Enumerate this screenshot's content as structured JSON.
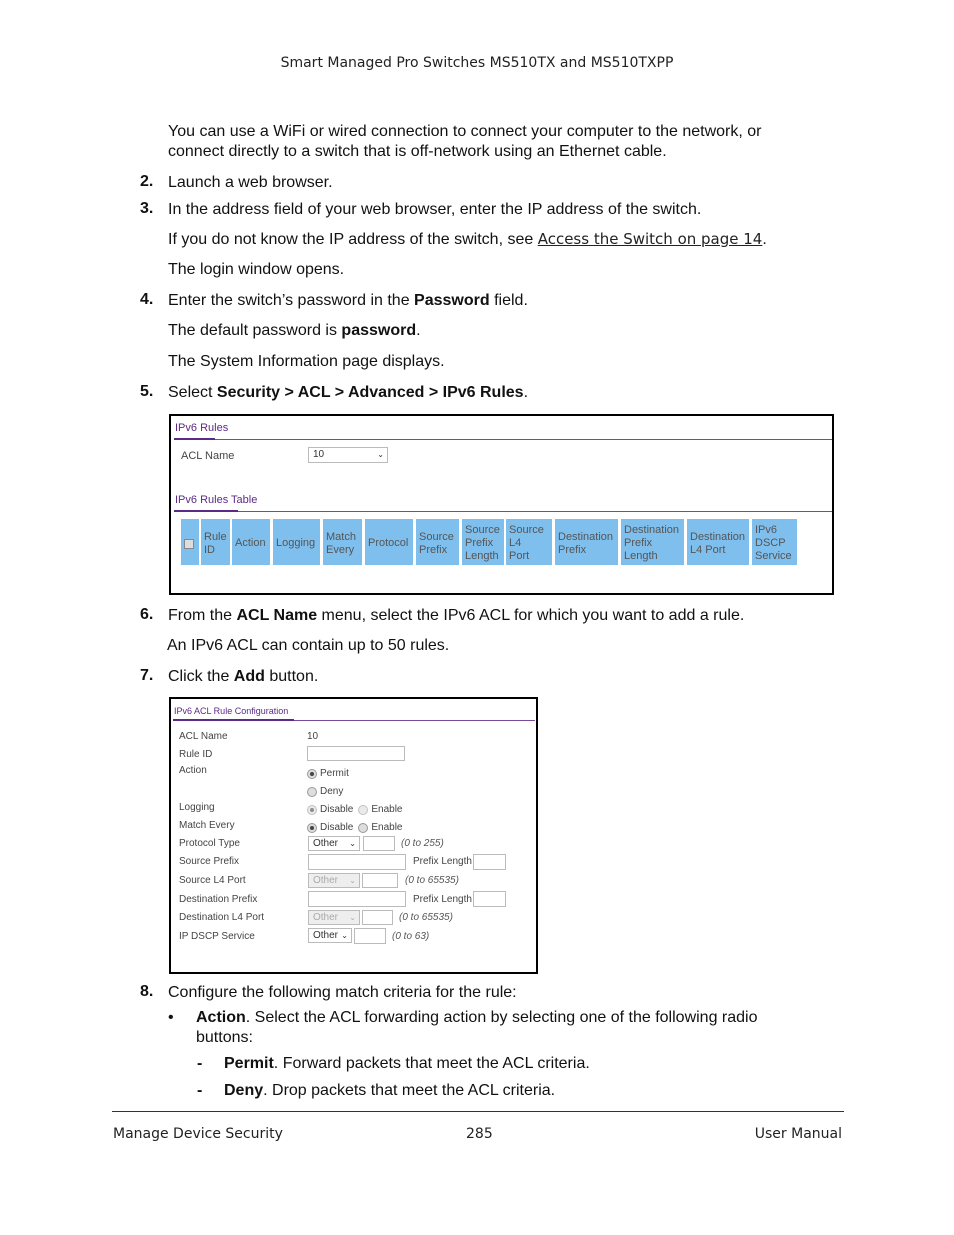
{
  "header": {
    "title": "Smart Managed Pro Switches MS510TX and MS510TXPP"
  },
  "body": {
    "intro": [
      "You can use a WiFi or wired connection to connect your computer to the network, or",
      "connect directly to a switch that is off-network using an Ethernet cable."
    ],
    "step2": {
      "num": "2.",
      "text": "Launch a web browser."
    },
    "step3": {
      "num": "3.",
      "text": "In the address field of your web browser, enter the IP address of the switch."
    },
    "step3_note_pre": "If you do not know the IP address of the switch, see ",
    "step3_link": "Access the Switch on page 14",
    "step3_note_post": ".",
    "login_opens": "The login window opens.",
    "step4": {
      "num": "4.",
      "pre": "Enter the switch’s password in the ",
      "bold": "Password",
      "post": " field."
    },
    "default_pre": "The default password is ",
    "default_bold": "password",
    "default_post": ".",
    "sysinfo": "The System Information page displays.",
    "step5": {
      "num": "5.",
      "pre": "Select ",
      "bold": "Security > ACL > Advanced > IPv6 Rules",
      "post": "."
    },
    "step6": {
      "num": "6.",
      "pre": "From the ",
      "bold": "ACL Name",
      "post": " menu, select the IPv6 ACL for which you want to add a rule."
    },
    "step6_note": "An IPv6 ACL can contain up to 50 rules.",
    "step7": {
      "num": "7.",
      "pre": "Click the ",
      "bold": "Add",
      "post": " button."
    },
    "step8": {
      "num": "8.",
      "text": "Configure the following match criteria for the rule:"
    },
    "bullet": {
      "sym": "•",
      "bold": "Action",
      "text1": ". Select the ACL forwarding action by selecting one of the following radio",
      "text2": "buttons:"
    },
    "sub": [
      {
        "sym": "-",
        "bold": "Permit",
        "text": ". Forward packets that meet the ACL criteria."
      },
      {
        "sym": "-",
        "bold": "Deny",
        "text": ". Drop packets that meet the ACL criteria."
      }
    ]
  },
  "shot1": {
    "section": "IPv6 Rules",
    "acl_label": "ACL Name",
    "acl_value": "10",
    "table_section": "IPv6 Rules Table",
    "columns": [
      "Rule ID",
      "Action",
      "Logging",
      "Match Every",
      "Protocol",
      "Source Prefix",
      "Source Prefix Length",
      "Source L4 Port",
      "Destination Prefix",
      "Destination Prefix Length",
      "Destination L4 Port",
      "IPv6 DSCP Service"
    ]
  },
  "shot2": {
    "section": "IPv6 ACL Rule Configuration",
    "labels": [
      "ACL Name",
      "Rule ID",
      "Action",
      "Logging",
      "Match Every",
      "Protocol Type",
      "Source Prefix",
      "Source L4 Port",
      "Destination Prefix",
      "Destination L4 Port",
      "IP DSCP Service"
    ],
    "acl_value": "10",
    "permit": "Permit",
    "deny": "Deny",
    "disable": "Disable",
    "enable": "Enable",
    "other": "Other",
    "prefix_length": "Prefix Length",
    "range_protocol": "(0 to 255)",
    "range_port": "(0 to 65535)",
    "range_dscp": "(0 to 63)"
  },
  "footer": {
    "left": "Manage Device Security",
    "page": "285",
    "right": "User Manual"
  }
}
